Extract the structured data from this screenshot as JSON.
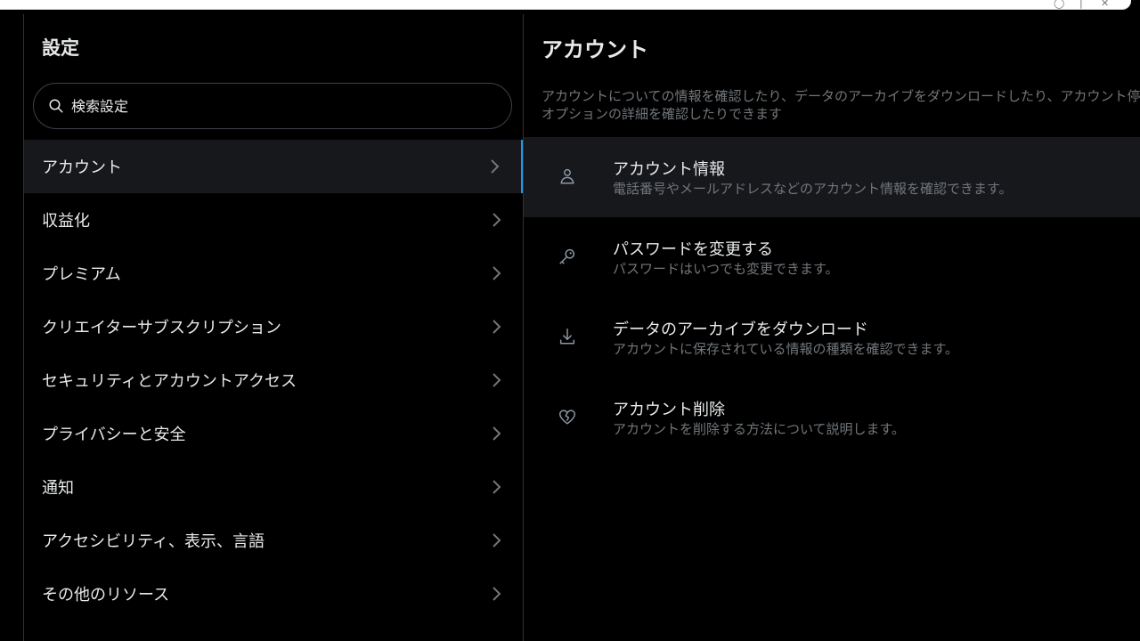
{
  "browser": {
    "controls": [
      "◯",
      "|",
      "✕"
    ]
  },
  "settings": {
    "title": "設定",
    "search_placeholder": "検索設定",
    "items": [
      {
        "label": "アカウント",
        "active": true
      },
      {
        "label": "収益化"
      },
      {
        "label": "プレミアム"
      },
      {
        "label": "クリエイターサブスクリプション"
      },
      {
        "label": "セキュリティとアカウントアクセス"
      },
      {
        "label": "プライバシーと安全"
      },
      {
        "label": "通知"
      },
      {
        "label": "アクセシビリティ、表示、言語"
      },
      {
        "label": "その他のリソース"
      }
    ]
  },
  "content": {
    "title": "アカウント",
    "description": "アカウントについての情報を確認したり、データのアーカイブをダウンロードしたり、アカウント停止オプションの詳細を確認したりできます",
    "options": [
      {
        "icon": "person-icon",
        "title": "アカウント情報",
        "subtitle": "電話番号やメールアドレスなどのアカウント情報を確認できます。"
      },
      {
        "icon": "key-icon",
        "title": "パスワードを変更する",
        "subtitle": "パスワードはいつでも変更できます。"
      },
      {
        "icon": "download-icon",
        "title": "データのアーカイブをダウンロード",
        "subtitle": "アカウントに保存されている情報の種類を確認できます。"
      },
      {
        "icon": "broken-heart-icon",
        "title": "アカウント削除",
        "subtitle": "アカウントを削除する方法について説明します。"
      }
    ]
  },
  "colors": {
    "background": "#000000",
    "text_primary": "#e7e9ea",
    "text_secondary": "#71767b",
    "active_row": "#16181c",
    "accent": "#1d9bf0",
    "border": "#2f3336"
  }
}
